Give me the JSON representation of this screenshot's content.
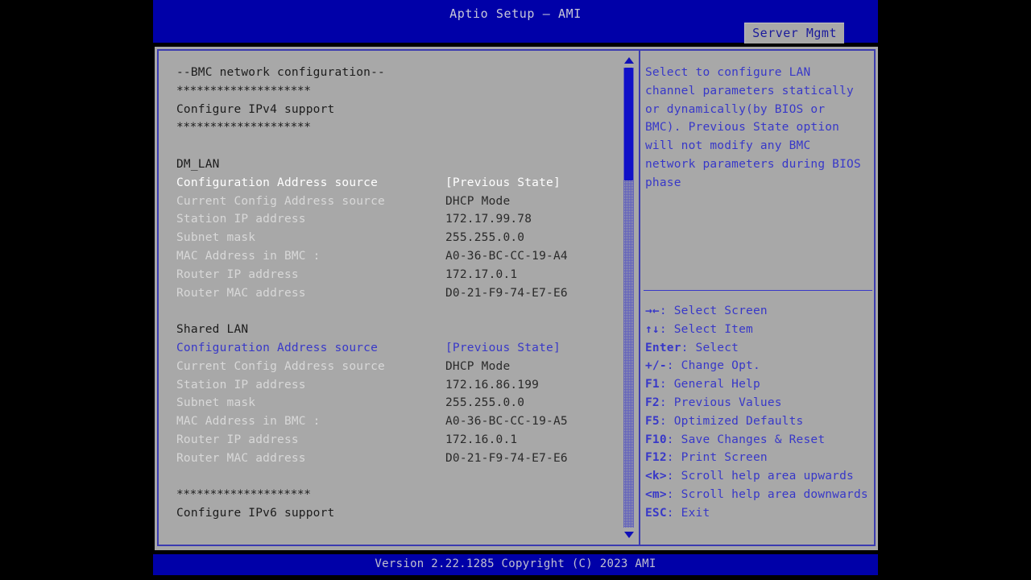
{
  "header": {
    "title": "Aptio Setup – AMI",
    "active_tab": "Server Mgmt"
  },
  "main": {
    "section_title": "--BMC network configuration--",
    "separator": "********************",
    "ipv4_heading": "Configure IPv4 support",
    "ipv6_heading": "Configure IPv6 support",
    "groups": [
      {
        "name": "DM_LAN",
        "rows": [
          {
            "label": "Configuration Address source",
            "value": "[Previous State]",
            "style": "white"
          },
          {
            "label": "Current Config Address source",
            "value": "DHCP Mode",
            "style": "dim"
          },
          {
            "label": "Station IP address",
            "value": "172.17.99.78",
            "style": "dim"
          },
          {
            "label": "Subnet mask",
            "value": "255.255.0.0",
            "style": "dim"
          },
          {
            "label": "MAC Address in BMC :",
            "value": "A0-36-BC-CC-19-A4",
            "style": "dim"
          },
          {
            "label": "Router IP address",
            "value": "172.17.0.1",
            "style": "dim"
          },
          {
            "label": "Router MAC address",
            "value": "D0-21-F9-74-E7-E6",
            "style": "dim"
          }
        ]
      },
      {
        "name": "Shared LAN",
        "rows": [
          {
            "label": "Configuration Address source",
            "value": "[Previous State]",
            "style": "selected"
          },
          {
            "label": "Current Config Address source",
            "value": "DHCP Mode",
            "style": "dim"
          },
          {
            "label": "Station IP address",
            "value": "172.16.86.199",
            "style": "dim"
          },
          {
            "label": "Subnet mask",
            "value": "255.255.0.0",
            "style": "dim"
          },
          {
            "label": "MAC Address in BMC :",
            "value": "A0-36-BC-CC-19-A5",
            "style": "dim"
          },
          {
            "label": "Router IP address",
            "value": "172.16.0.1",
            "style": "dim"
          },
          {
            "label": "Router MAC address",
            "value": "D0-21-F9-74-E7-E6",
            "style": "dim"
          }
        ]
      }
    ]
  },
  "scrollbar": {
    "up_arrow": "▲",
    "down_arrow": "▼"
  },
  "help": {
    "lines": [
      "Select to configure LAN",
      "channel parameters statically",
      "or dynamically(by BIOS or",
      "BMC). Previous State option",
      "will not modify any BMC",
      "network parameters during BIOS",
      "phase"
    ]
  },
  "legend": {
    "items": [
      {
        "key": "→←",
        "text": ": Select Screen"
      },
      {
        "key": "↑↓",
        "text": ": Select Item"
      },
      {
        "key": "Enter",
        "text": ": Select"
      },
      {
        "key": "+/-",
        "text": ": Change Opt."
      },
      {
        "key": "F1",
        "text": ": General Help"
      },
      {
        "key": "F2",
        "text": ": Previous Values"
      },
      {
        "key": "F5",
        "text": ": Optimized Defaults"
      },
      {
        "key": "F10",
        "text": ": Save Changes & Reset"
      },
      {
        "key": "F12",
        "text": ": Print Screen"
      },
      {
        "key": "<k>",
        "text": ": Scroll help area upwards"
      },
      {
        "key": "<m>",
        "text": ": Scroll help area downwards"
      },
      {
        "key": "ESC",
        "text": ": Exit"
      }
    ]
  },
  "footer": {
    "version": "Version 2.22.1285 Copyright (C) 2023 AMI"
  },
  "colors": {
    "header_blue": "#0000a8",
    "panel_gray": "#a8a8a8",
    "border_blue": "#3b3bb0",
    "selected_blue": "#3838c8",
    "scrollbar_blue": "#1010c8"
  }
}
